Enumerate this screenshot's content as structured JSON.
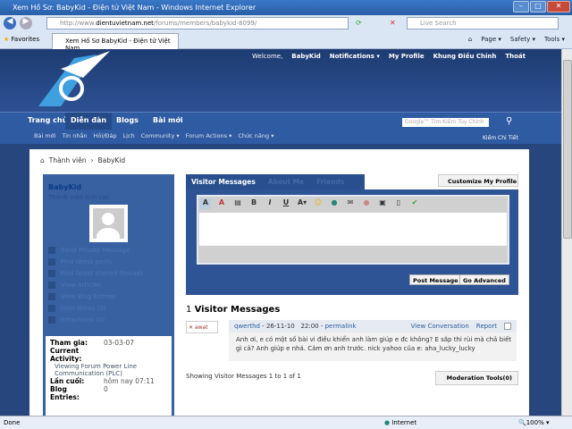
{
  "browser": {
    "title": "Xem Hồ Sơ: BabyKid - Điện tử Việt Nam - Windows Internet Explorer",
    "url_prefix": "http://www.",
    "url_domain": "dientuvietnam.net",
    "url_path": "/forums/members/babykid-8099/",
    "search_placeholder": "Live Search",
    "favorites": "Favorites",
    "tab_title": "Xem Hồ Sơ BabyKid - Điện tử Việt Nam",
    "tools": [
      "Page ▾",
      "Safety ▾",
      "Tools ▾"
    ],
    "status": "Done",
    "zone": "Internet",
    "zoom": "100%"
  },
  "top": {
    "welcome": "Welcome,",
    "user": "BabyKid",
    "links": [
      "Notifications ▾",
      "My Profile",
      "Khung Điều Chỉnh",
      "Thoát"
    ]
  },
  "nav": {
    "items": [
      "Trang chủ",
      "Diễn đàn",
      "Blogs",
      "Bài mới"
    ],
    "sub": [
      "Bài mới",
      "Tin nhắn",
      "Hỏi/Đáp",
      "Lịch",
      "Community ▾",
      "Forum Actions ▾",
      "Chức năng ▾"
    ],
    "search_placeholder": "Tìm Kiếm Tùy Chỉnh",
    "search_brand": "Google™",
    "advanced": "Kiếm Chi Tiết"
  },
  "breadcrumb": [
    "Thành viên",
    "BabyKid"
  ],
  "sidebar": {
    "name": "BabyKid",
    "title": "Thành viên tích cực",
    "links": [
      "Send Private Message",
      "Find latest posts",
      "Find latest started threads",
      "View Articles",
      "View Blog Entries",
      "User Notes (0)",
      "Infractions (0)"
    ],
    "stats": [
      {
        "k": "Tham gia:",
        "v": "03-03-07"
      },
      {
        "k": "Current Activity:",
        "v": ""
      },
      {
        "k": "",
        "v": "Viewing Forum Power Line Communication (PLC)"
      },
      {
        "k": "Lần cuối:",
        "v": "hôm nay 07:11"
      },
      {
        "k": "Blog Entries:",
        "v": "0"
      }
    ]
  },
  "main": {
    "tabs": [
      "Visitor Messages",
      "About Me",
      "Friends"
    ],
    "customize": "Customize My Profile",
    "post": "Post Message",
    "advanced": "Go Advanced",
    "count": "1",
    "heading": "Visitor Messages",
    "message": {
      "avatar": "awat",
      "author": "qwerthd",
      "date": "26-11-10",
      "time": "22:00",
      "permalink": "permalink",
      "view": "View Conversation",
      "report": "Report",
      "body": "Anh ơi, e có một số bài vi điều khiển anh làm giúp e đc không? E sắp thi rùi mà chả biết gì cả? Anh giúp e nhá. Cảm ơn anh trước. nick yahoo của e: aha_lucky_lucky"
    },
    "showing": "Showing Visitor Messages 1 to 1 of 1",
    "moderation": "Moderation Tools(0)"
  }
}
